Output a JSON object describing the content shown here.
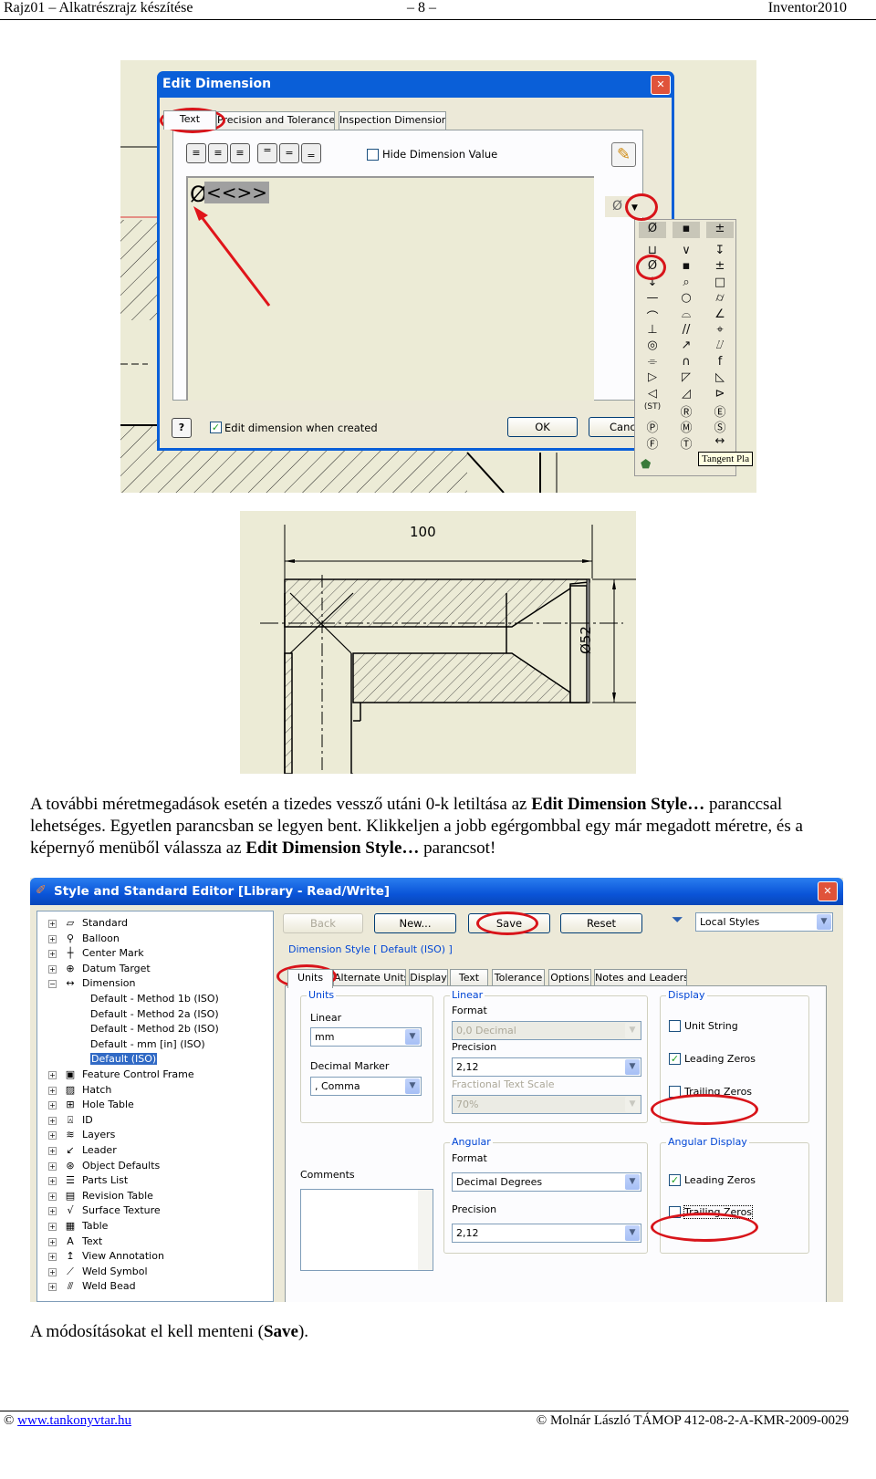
{
  "header": {
    "left": "Rajz01 – Alkatrészrajz készítése",
    "center": "– 8 –",
    "right": "Inventor2010"
  },
  "edit_dimension": {
    "title": "Edit Dimension",
    "tabs": [
      "Text",
      "Precision and Tolerance",
      "Inspection Dimension"
    ],
    "hide_dimension_value": "Hide Dimension Value",
    "text_symbol": "Ø",
    "text_value": "<<>>",
    "symbol_button": "Ø",
    "edit_when_created": "Edit dimension when created",
    "edit_when_created_checked": true,
    "ok": "OK",
    "cancel": "Canc",
    "help": "?",
    "palette_header": [
      "Ø",
      "▪",
      "±"
    ],
    "palette": [
      [
        "⊔",
        "∨",
        "↧"
      ],
      [
        "Ø",
        "▪",
        "±"
      ],
      [
        "↓",
        "⌕",
        "□"
      ],
      [
        "—",
        "○",
        "⌭"
      ],
      [
        "⌒",
        "⌓",
        "∠"
      ],
      [
        "⊥",
        "//",
        "⌖"
      ],
      [
        "◎",
        "↗",
        "⌰"
      ],
      [
        "⌯",
        "∩",
        "f"
      ],
      [
        "▷",
        "◸",
        "◺"
      ],
      [
        "◁",
        "◿",
        "⊳"
      ],
      [
        "(ST)",
        "Ⓡ",
        "Ⓔ"
      ],
      [
        "Ⓟ",
        "Ⓜ",
        "Ⓢ"
      ],
      [
        "Ⓕ",
        "Ⓣ",
        "↔"
      ]
    ],
    "tooltip": "Tangent Pla"
  },
  "drawing": {
    "dim_length": "100",
    "dim_diameter": "Ø52"
  },
  "paragraph": {
    "p1": "A további méretmegadások esetén a tizedes vessző utáni 0-k letiltása az ",
    "b1": "Edit Dimension Style…",
    "p2": " paranccsal lehetséges. Egyetlen parancsban se legyen bent. Klikkeljen a jobb egérgombbal egy már megadott méretre, és a képernyő menüből válassza az ",
    "b2": "Edit Dimension Style…",
    "p3": " parancsot!"
  },
  "style_editor": {
    "title": "Style and Standard Editor [Library - Read/Write]",
    "tree": [
      {
        "label": "Standard",
        "icon": "▱",
        "exp": "+"
      },
      {
        "label": "Balloon",
        "icon": "⚲",
        "exp": "+"
      },
      {
        "label": "Center Mark",
        "icon": "┼",
        "exp": "+"
      },
      {
        "label": "Datum Target",
        "icon": "⊕",
        "exp": "+"
      },
      {
        "label": "Dimension",
        "icon": "↔",
        "exp": "−"
      },
      {
        "label": "Default - Method 1b (ISO)",
        "child": true
      },
      {
        "label": "Default - Method 2a (ISO)",
        "child": true
      },
      {
        "label": "Default - Method 2b (ISO)",
        "child": true
      },
      {
        "label": "Default - mm [in] (ISO)",
        "child": true
      },
      {
        "label": "Default (ISO)",
        "child": true,
        "selected": true
      },
      {
        "label": "Feature Control Frame",
        "icon": "▣",
        "exp": "+"
      },
      {
        "label": "Hatch",
        "icon": "▨",
        "exp": "+"
      },
      {
        "label": "Hole Table",
        "icon": "⊞",
        "exp": "+"
      },
      {
        "label": "ID",
        "icon": "⍓",
        "exp": "+"
      },
      {
        "label": "Layers",
        "icon": "≋",
        "exp": "+"
      },
      {
        "label": "Leader",
        "icon": "↙",
        "exp": "+"
      },
      {
        "label": "Object Defaults",
        "icon": "⊛",
        "exp": "+"
      },
      {
        "label": "Parts List",
        "icon": "☰",
        "exp": "+"
      },
      {
        "label": "Revision Table",
        "icon": "▤",
        "exp": "+"
      },
      {
        "label": "Surface Texture",
        "icon": "√",
        "exp": "+"
      },
      {
        "label": "Table",
        "icon": "▦",
        "exp": "+"
      },
      {
        "label": "Text",
        "icon": "A",
        "exp": "+"
      },
      {
        "label": "View Annotation",
        "icon": "↥",
        "exp": "+"
      },
      {
        "label": "Weld Symbol",
        "icon": "⟋",
        "exp": "+"
      },
      {
        "label": "Weld Bead",
        "icon": "⫻",
        "exp": "+"
      }
    ],
    "buttons": {
      "back": "Back",
      "new": "New...",
      "save": "Save",
      "reset": "Reset"
    },
    "filter": "Local Styles",
    "style_heading": "Dimension Style [ Default (ISO) ]",
    "tabs": [
      "Units",
      "Alternate Units",
      "Display",
      "Text",
      "Tolerance",
      "Options",
      "Notes and Leaders"
    ],
    "units_group": {
      "title": "Units",
      "linear_label": "Linear",
      "linear_value": "mm",
      "decimal_marker_label": "Decimal Marker",
      "decimal_marker_value": ", Comma"
    },
    "linear_group": {
      "title": "Linear",
      "format_label": "Format",
      "format_value": "0,0 Decimal",
      "precision_label": "Precision",
      "precision_value": "2,12",
      "fts_label": "Fractional Text Scale",
      "fts_value": "70%"
    },
    "display_group": {
      "title": "Display",
      "unit_string": "Unit String",
      "unit_string_checked": false,
      "leading_zeros": "Leading Zeros",
      "leading_zeros_checked": true,
      "trailing_zeros": "Trailing Zeros",
      "trailing_zeros_checked": false
    },
    "comments_label": "Comments",
    "angular_group": {
      "title": "Angular",
      "format_label": "Format",
      "format_value": "Decimal Degrees",
      "precision_label": "Precision",
      "precision_value": "2,12"
    },
    "angular_display_group": {
      "title": "Angular Display",
      "leading_zeros": "Leading Zeros",
      "leading_zeros_checked": true,
      "trailing_zeros": "Trailing Zeros",
      "trailing_zeros_checked": false
    }
  },
  "closing": {
    "p1": "A módosításokat el kell menteni (",
    "b": "Save",
    "p2": ")."
  },
  "footer": {
    "left_prefix": "© ",
    "link": "www.tankonyvtar.hu",
    "right": "© Molnár László TÁMOP 412-08-2-A-KMR-2009-0029"
  },
  "colors": {
    "xp_title": "#0a5fd8",
    "highlight": "#d8141a",
    "cad_bg": "#ecebd6"
  }
}
